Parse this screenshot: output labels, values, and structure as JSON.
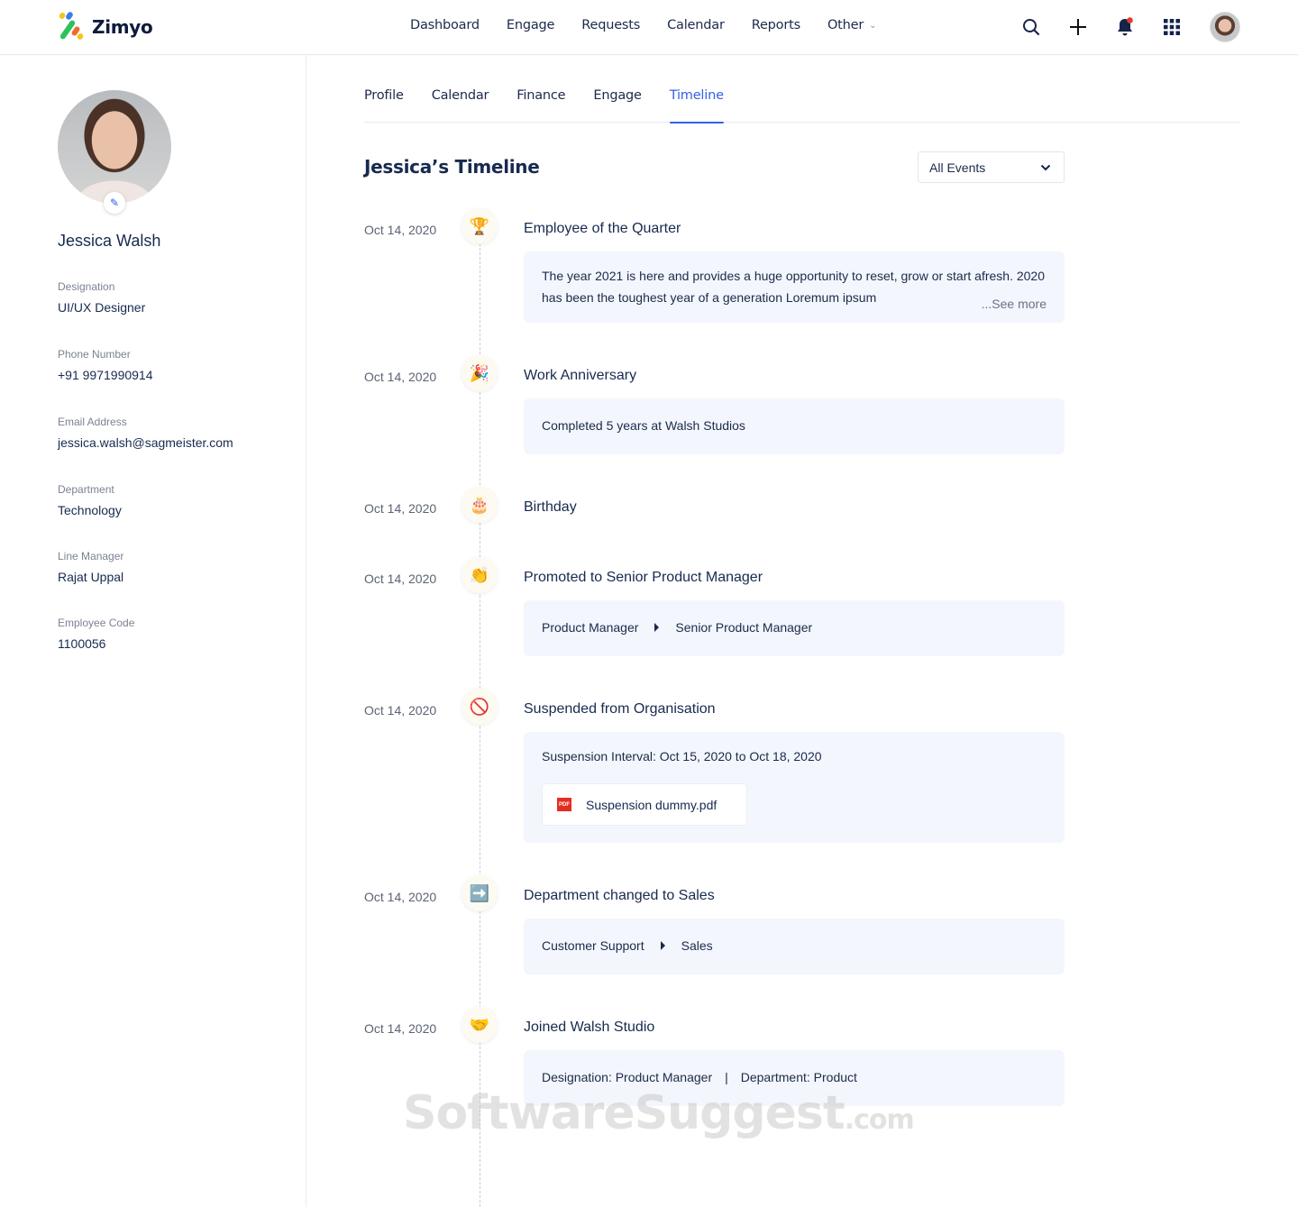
{
  "app": {
    "name": "Zimyo"
  },
  "nav": {
    "items": [
      "Dashboard",
      "Engage",
      "Requests",
      "Calendar",
      "Reports",
      "Other"
    ]
  },
  "top_icons": [
    "search-icon",
    "plus-icon",
    "bell-icon",
    "apps-grid-icon",
    "user-avatar"
  ],
  "colors": {
    "accent": "#3461e8",
    "notification": "#e53a2a",
    "card_bg": "#f3f6fd",
    "text": "#172a4f"
  },
  "profile": {
    "name": "Jessica Walsh",
    "fields": [
      {
        "label": "Designation",
        "value": "UI/UX Designer"
      },
      {
        "label": "Phone Number",
        "value": "+91 9971990914"
      },
      {
        "label": "Email Address",
        "value": "jessica.walsh@sagmeister.com"
      },
      {
        "label": "Department",
        "value": "Technology"
      },
      {
        "label": "Line Manager",
        "value": "Rajat Uppal"
      },
      {
        "label": "Employee Code",
        "value": "1100056"
      }
    ]
  },
  "tabs": [
    "Profile",
    "Calendar",
    "Finance",
    "Engage",
    "Timeline"
  ],
  "active_tab": "Timeline",
  "timeline": {
    "title": "Jessica’s Timeline",
    "filter": {
      "selected": "All Events"
    },
    "events": [
      {
        "date": "Oct 14, 2020",
        "icon": "🏆",
        "icon_name": "trophy-icon",
        "title": "Employee of the Quarter",
        "body": "The year 2021 is here and provides a huge opportunity to reset, grow or start afresh. 2020 has been the toughest year of a generation Loremum ipsum",
        "see_more": "...See more"
      },
      {
        "date": "Oct 14, 2020",
        "icon": "🎉",
        "icon_name": "party-popper-icon",
        "title": "Work Anniversary",
        "body": "Completed 5 years at Walsh Studios"
      },
      {
        "date": "Oct 14, 2020",
        "icon": "🎂",
        "icon_name": "birthday-cake-icon",
        "title": "Birthday"
      },
      {
        "date": "Oct 14, 2020",
        "icon": "👏",
        "icon_name": "clapping-hands-icon",
        "title": "Promoted to Senior Product Manager",
        "from": "Product Manager",
        "to": "Senior Product Manager"
      },
      {
        "date": "Oct 14, 2020",
        "icon": "🚫",
        "icon_name": "prohibited-icon",
        "title": "Suspended from Organisation",
        "body": "Suspension Interval: Oct 15, 2020 to Oct 18, 2020",
        "attachment": "Suspension dummy.pdf",
        "attachment_badge": "PDF"
      },
      {
        "date": "Oct 14, 2020",
        "icon": "➡️",
        "icon_name": "right-arrow-icon",
        "title": "Department changed to Sales",
        "from": "Customer Support",
        "to": "Sales"
      },
      {
        "date": "Oct 14, 2020",
        "icon": "🤝",
        "icon_name": "handshake-icon",
        "title": "Joined Walsh Studio",
        "designation": "Designation: Product Manager",
        "separator": "|",
        "department": "Department: Product"
      }
    ]
  },
  "watermark": {
    "main": "SoftwareSuggest",
    "suffix": ".com"
  }
}
